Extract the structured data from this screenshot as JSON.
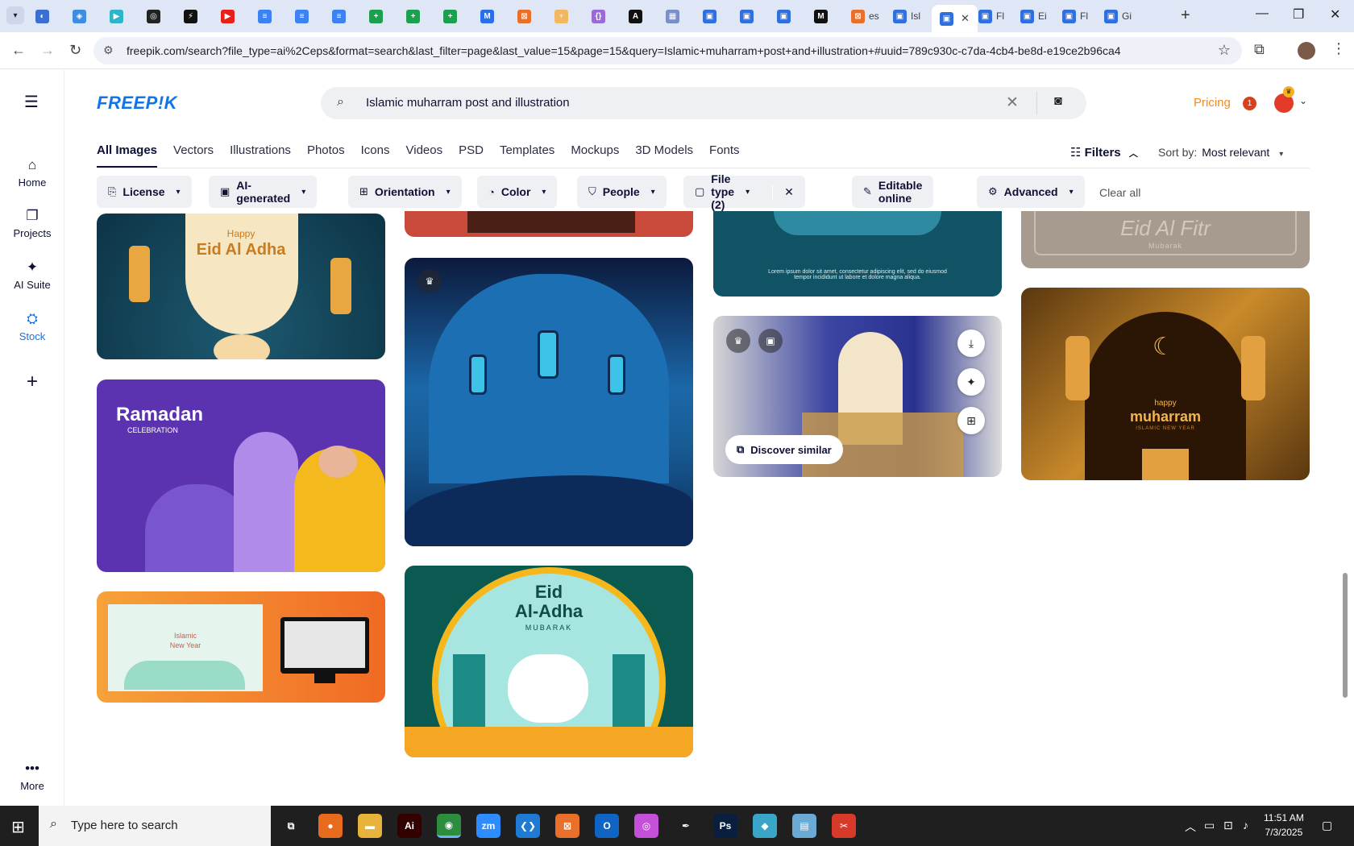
{
  "browser": {
    "tabs": [
      {
        "label": "",
        "color": "#3b6fd4",
        "glyph": "◐"
      },
      {
        "label": "",
        "color": "#3f8de0",
        "glyph": "◈"
      },
      {
        "label": "",
        "color": "#2fb4c9",
        "glyph": "▶"
      },
      {
        "label": "",
        "color": "#222222",
        "glyph": "◎"
      },
      {
        "label": "",
        "color": "#111111",
        "glyph": "⚡"
      },
      {
        "label": "",
        "color": "#e62117",
        "glyph": "▶"
      },
      {
        "label": "",
        "color": "#3d82f2",
        "glyph": "≡"
      },
      {
        "label": "",
        "color": "#3d82f2",
        "glyph": "≡"
      },
      {
        "label": "",
        "color": "#3d82f2",
        "glyph": "≡"
      },
      {
        "label": "",
        "color": "#1e9e4f",
        "glyph": "+"
      },
      {
        "label": "",
        "color": "#1e9e4f",
        "glyph": "+"
      },
      {
        "label": "",
        "color": "#1e9e4f",
        "glyph": "+"
      },
      {
        "label": "",
        "color": "#2a6ee8",
        "glyph": "M"
      },
      {
        "label": "",
        "color": "#e8702a",
        "glyph": "⊠"
      },
      {
        "label": "",
        "color": "#f0b860",
        "glyph": "♆"
      },
      {
        "label": "",
        "color": "#9a6ad8",
        "glyph": "{}"
      },
      {
        "label": "",
        "color": "#111111",
        "glyph": "A"
      },
      {
        "label": "",
        "color": "#7a8fc7",
        "glyph": "▦"
      },
      {
        "label": "",
        "color": "#2f6fe0",
        "glyph": "▣"
      },
      {
        "label": "",
        "color": "#2f6fe0",
        "glyph": "▣"
      },
      {
        "label": "",
        "color": "#2f6fe0",
        "glyph": "▣"
      },
      {
        "label": "",
        "color": "#111111",
        "glyph": "M"
      },
      {
        "label": "es",
        "color": "#e8702a",
        "glyph": "⊠"
      },
      {
        "label": "Isl",
        "color": "#2f6fe0",
        "glyph": "▣"
      }
    ],
    "active_tab": {
      "label": "",
      "color": "#2f6fe0",
      "glyph": "▣"
    },
    "tabs_after": [
      {
        "label": "Fl",
        "color": "#2f6fe0",
        "glyph": "▣"
      },
      {
        "label": "Ei",
        "color": "#2f6fe0",
        "glyph": "▣"
      },
      {
        "label": "Fl",
        "color": "#2f6fe0",
        "glyph": "▣"
      },
      {
        "label": "Gi",
        "color": "#2f6fe0",
        "glyph": "▣"
      }
    ],
    "url": "freepik.com/search?file_type=ai%2Ceps&format=search&last_filter=page&last_value=15&page=15&query=Islamic+muharram+post+and+illustration+#uuid=789c930c-c7da-4cb4-be8d-e19ce2b96ca4"
  },
  "site": {
    "logo": "FREEP!K",
    "search_query": "Islamic muharram post and illustration",
    "pricing": "Pricing",
    "notif_count": "1"
  },
  "rail": [
    {
      "label": "Home",
      "icon": "⌂"
    },
    {
      "label": "Projects",
      "icon": "❐"
    },
    {
      "label": "AI Suite",
      "icon": "✦"
    },
    {
      "label": "Stock",
      "icon": "⛭"
    },
    {
      "label": "",
      "icon": "+"
    }
  ],
  "rail_more": "More",
  "type_tabs": [
    "All Images",
    "Vectors",
    "Illustrations",
    "Photos",
    "Icons",
    "Videos",
    "PSD",
    "Templates",
    "Mockups",
    "3D Models",
    "Fonts"
  ],
  "filters_label": "Filters",
  "sort": {
    "label": "Sort by:",
    "value": "Most relevant"
  },
  "chips": [
    {
      "label": "License",
      "icon": "⎘",
      "chev": true
    },
    {
      "label": "AI-generated",
      "icon": "▣",
      "chev": true
    },
    {
      "label": "Orientation",
      "icon": "⊞",
      "chev": true
    },
    {
      "label": "Color",
      "icon": "◔",
      "chev": true
    },
    {
      "label": "People",
      "icon": "⛉",
      "chev": true
    },
    {
      "label": "File type (2)",
      "icon": "▢",
      "chev": true
    },
    {
      "label": "Editable online",
      "icon": "✎",
      "chev": false
    },
    {
      "label": "Advanced",
      "icon": "⚙",
      "chev": true
    }
  ],
  "clear_all": "Clear all",
  "cards": {
    "eid_adha_1": {
      "line1": "Happy",
      "line2": "Eid Al Adha"
    },
    "ramadan": {
      "line1": "Ramadan",
      "line2": "CELEBRATION"
    },
    "new_year": {
      "line1": "Islamic",
      "line2": "New Year"
    },
    "eid_fitr": {
      "line1": "Eid Al Fitr",
      "line2": "Mubarak"
    },
    "muharram": {
      "line1": "happy",
      "line2": "muharram",
      "line3": "ISLAMIC NEW YEAR"
    },
    "eid_adha_2": {
      "line1": "Eid",
      "line2": "Al-Adha",
      "line3": "MUBARAK"
    },
    "lorem": "Lorem ipsum dolor sit amet, consectetur adipiscing elit, sed do eiusmod tempor incididunt ut labore et dolore magna aliqua.",
    "discover": "Discover similar"
  },
  "taskbar": {
    "search_placeholder": "Type here to search",
    "time": "11:51 AM",
    "date": "7/3/2025",
    "apps": [
      {
        "name": "task-view",
        "glyph": "⧉",
        "color": "#1f1f1f"
      },
      {
        "name": "firefox",
        "glyph": "●",
        "color": "#e76a1f"
      },
      {
        "name": "file-explorer",
        "glyph": "▬",
        "color": "#e8b33a"
      },
      {
        "name": "illustrator",
        "glyph": "Ai",
        "color": "#330000"
      },
      {
        "name": "chrome",
        "glyph": "◉",
        "color": "#2d8d3f"
      },
      {
        "name": "zoom",
        "glyph": "zm",
        "color": "#2d8cff"
      },
      {
        "name": "vscode",
        "glyph": "❮❯",
        "color": "#1f7ad4"
      },
      {
        "name": "app-orange",
        "glyph": "⊠",
        "color": "#e8702a"
      },
      {
        "name": "outlook",
        "glyph": "O",
        "color": "#0f64c4"
      },
      {
        "name": "app-gradient",
        "glyph": "◎",
        "color": "#c44fd8"
      },
      {
        "name": "pen-tool",
        "glyph": "✒",
        "color": "#1f1f1f"
      },
      {
        "name": "photoshop",
        "glyph": "Ps",
        "color": "#0a1f3f"
      },
      {
        "name": "app-teal",
        "glyph": "◆",
        "color": "#3aa6c7"
      },
      {
        "name": "app-notepad",
        "glyph": "▤",
        "color": "#6aaad4"
      },
      {
        "name": "app-snip",
        "glyph": "✂",
        "color": "#d83a2a"
      }
    ]
  }
}
